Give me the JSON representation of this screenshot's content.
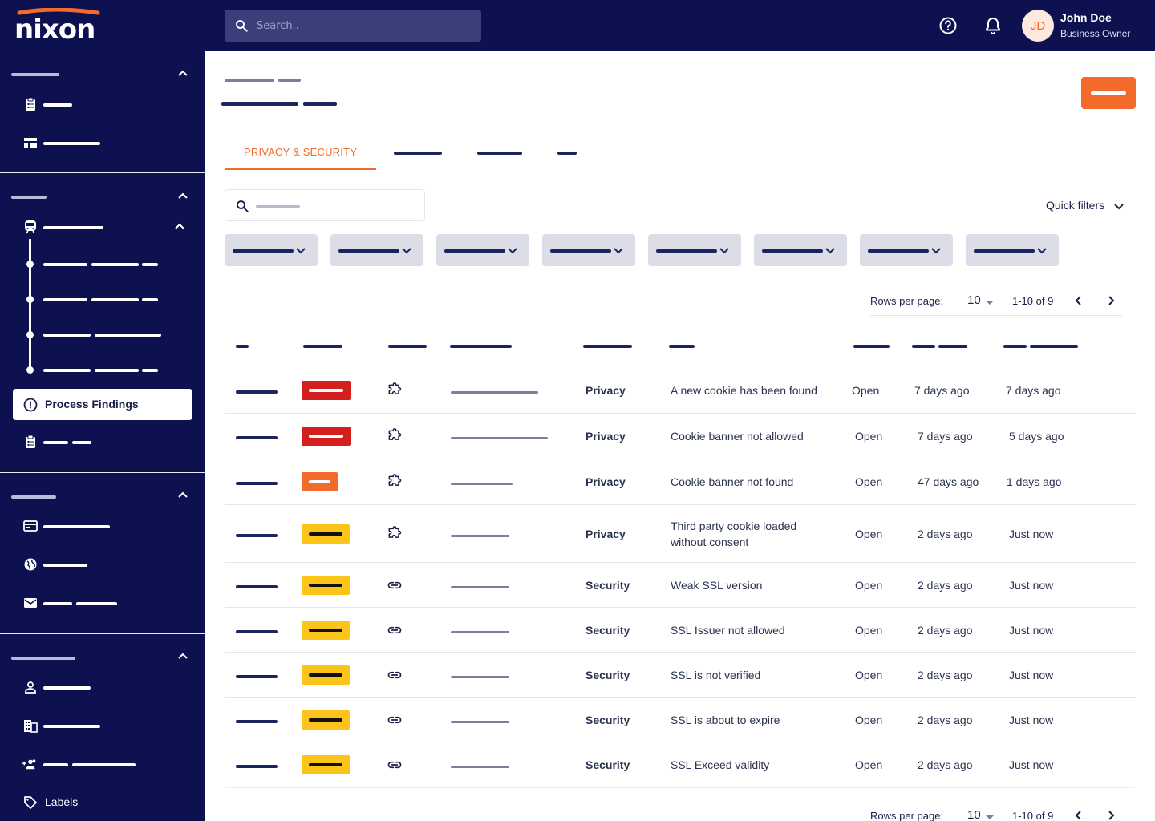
{
  "app": {
    "logo_text": "nixon",
    "brand_color": "#f26b2a",
    "navy_color": "#0d1150"
  },
  "header": {
    "search_placeholder": "Search..",
    "help_icon": "help-circle-icon",
    "bell_icon": "bell-icon",
    "user": {
      "initials": "JD",
      "name": "John Doe",
      "role": "Business Owner"
    }
  },
  "sidebar": {
    "active_item": "Process Findings",
    "labels_item": "Labels"
  },
  "tabs": {
    "active": "PRIVACY & SECURITY"
  },
  "toolbar": {
    "quick_filters": "Quick filters"
  },
  "pagination": {
    "rows_per_page_label": "Rows per page:",
    "rows_per_page": "10",
    "range": "1-10 of 9"
  },
  "severity_colors": {
    "critical": "#d41f1f",
    "high": "#f26b2a",
    "medium": "#fcc419"
  },
  "findings": [
    {
      "severity": "critical",
      "icon": "puzzle-icon",
      "category": "Privacy",
      "title": "A new cookie has been found",
      "status": "Open",
      "created": "7 days ago",
      "updated": "7 days ago"
    },
    {
      "severity": "critical",
      "icon": "puzzle-icon",
      "category": "Privacy",
      "title": "Cookie banner not allowed",
      "status": "Open",
      "created": "7 days ago",
      "updated": "5 days ago"
    },
    {
      "severity": "high",
      "icon": "puzzle-icon",
      "category": "Privacy",
      "title": "Cookie banner not found",
      "status": "Open",
      "created": "47 days ago",
      "updated": "1 days ago"
    },
    {
      "severity": "medium",
      "icon": "puzzle-icon",
      "category": "Privacy",
      "title_line1": "Third party cookie loaded",
      "title_line2": "without consent",
      "status": "Open",
      "created": "2 days ago",
      "updated": "Just now"
    },
    {
      "severity": "medium",
      "icon": "link-icon",
      "category": "Security",
      "title": "Weak SSL version",
      "status": "Open",
      "created": "2 days ago",
      "updated": "Just now"
    },
    {
      "severity": "medium",
      "icon": "link-icon",
      "category": "Security",
      "title": "SSL Issuer not allowed",
      "status": "Open",
      "created": "2 days ago",
      "updated": "Just now"
    },
    {
      "severity": "medium",
      "icon": "link-icon",
      "category": "Security",
      "title": "SSL is not verified",
      "status": "Open",
      "created": "2 days ago",
      "updated": "Just now"
    },
    {
      "severity": "medium",
      "icon": "link-icon",
      "category": "Security",
      "title": "SSL is about to expire",
      "status": "Open",
      "created": "2 days ago",
      "updated": "Just now"
    },
    {
      "severity": "medium",
      "icon": "link-icon",
      "category": "Security",
      "title": "SSL Exceed validity",
      "status": "Open",
      "created": "2 days ago",
      "updated": "Just now"
    }
  ]
}
